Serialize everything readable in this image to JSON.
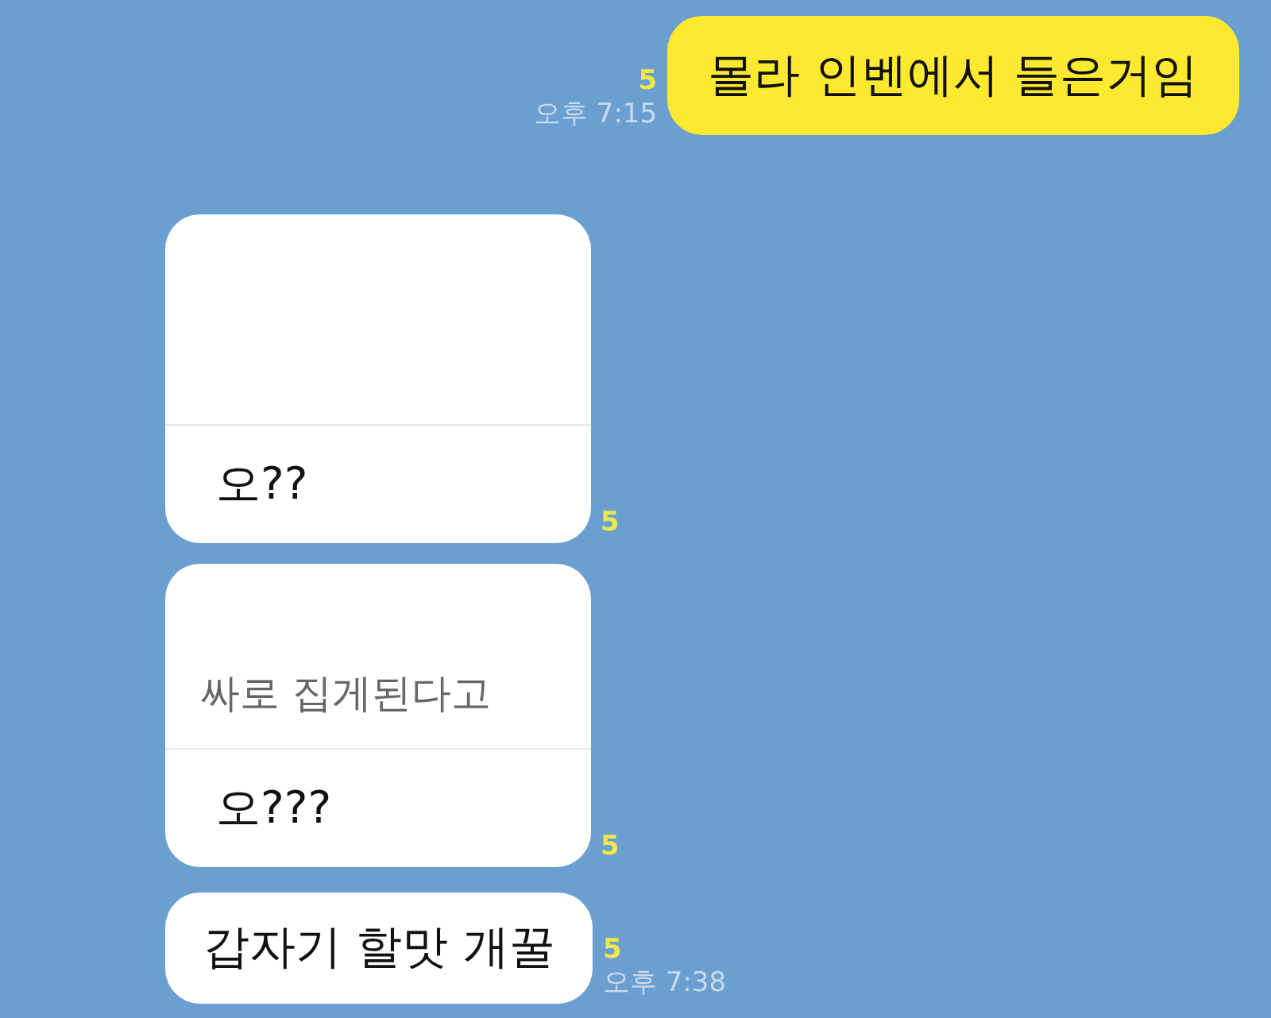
{
  "messages": [
    {
      "kind": "sent",
      "text": "몰라 인벤에서 들은거임",
      "unread": "5",
      "time": "오후 7:15"
    },
    {
      "kind": "reply",
      "text": "오??",
      "unread": "5"
    },
    {
      "kind": "reply",
      "quote": "싸로 집게된다고",
      "text": "오???",
      "unread": "5"
    },
    {
      "kind": "received",
      "text": "갑자기 할맛 개꿀",
      "unread": "5",
      "time": "오후 7:38"
    }
  ]
}
